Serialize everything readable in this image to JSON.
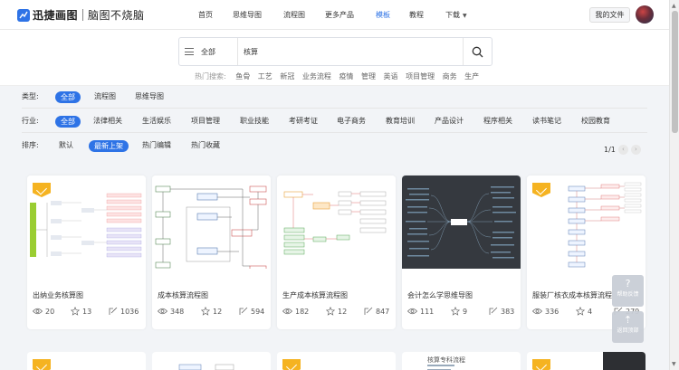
{
  "brand": {
    "name": "迅捷画图",
    "slogan": "脑图不烧脑",
    "color": "#2e73e6"
  },
  "nav": {
    "items": [
      "首页",
      "思维导图",
      "流程图",
      "更多产品",
      "模板",
      "教程",
      "下载"
    ],
    "active": "模板",
    "my_files": "我的文件"
  },
  "search": {
    "type_label": "全部",
    "value": "核算",
    "hot_label": "热门搜索:",
    "hot_items": [
      "鱼骨",
      "工艺",
      "新冠",
      "业务流程",
      "疫情",
      "管理",
      "英语",
      "项目管理",
      "商务",
      "生产"
    ]
  },
  "filters": {
    "type": {
      "label": "类型:",
      "items": [
        "全部",
        "流程图",
        "思维导图"
      ],
      "selected": "全部"
    },
    "industry": {
      "label": "行业:",
      "items": [
        "全部",
        "法律相关",
        "生活娱乐",
        "项目管理",
        "职业技能",
        "考研考证",
        "电子商务",
        "教育培训",
        "产品设计",
        "程序相关",
        "读书笔记",
        "校园教育"
      ],
      "selected": "全部"
    },
    "sort": {
      "label": "排序:",
      "items": [
        "默认",
        "最新上架",
        "热门编辑",
        "热门收藏"
      ],
      "selected": "最新上架"
    },
    "pagination": {
      "text": "1/1",
      "prev": "‹",
      "next": "›"
    }
  },
  "cards": [
    {
      "title": "出纳业务核算图",
      "views": "20",
      "favorites": "13",
      "edits": "1036",
      "vip": true,
      "theme": "light"
    },
    {
      "title": "成本核算流程图",
      "views": "348",
      "favorites": "12",
      "edits": "594",
      "vip": false,
      "theme": "light"
    },
    {
      "title": "生产成本核算流程图",
      "views": "182",
      "favorites": "12",
      "edits": "847",
      "vip": false,
      "theme": "light"
    },
    {
      "title": "会计怎么学思维导图",
      "views": "111",
      "favorites": "9",
      "edits": "383",
      "vip": false,
      "theme": "dark"
    },
    {
      "title": "服装厂核衣成本核算流程",
      "views": "336",
      "favorites": "4",
      "edits": "279",
      "vip": true,
      "theme": "light"
    }
  ],
  "row2_thumb_text": "核算专科流程",
  "float_buttons": {
    "feedback": "帮助反馈",
    "top": "返回顶部"
  },
  "colors": {
    "accent": "#2e73e6",
    "vip_gold": "#f5b321",
    "page_bg": "#f2f4f7"
  }
}
